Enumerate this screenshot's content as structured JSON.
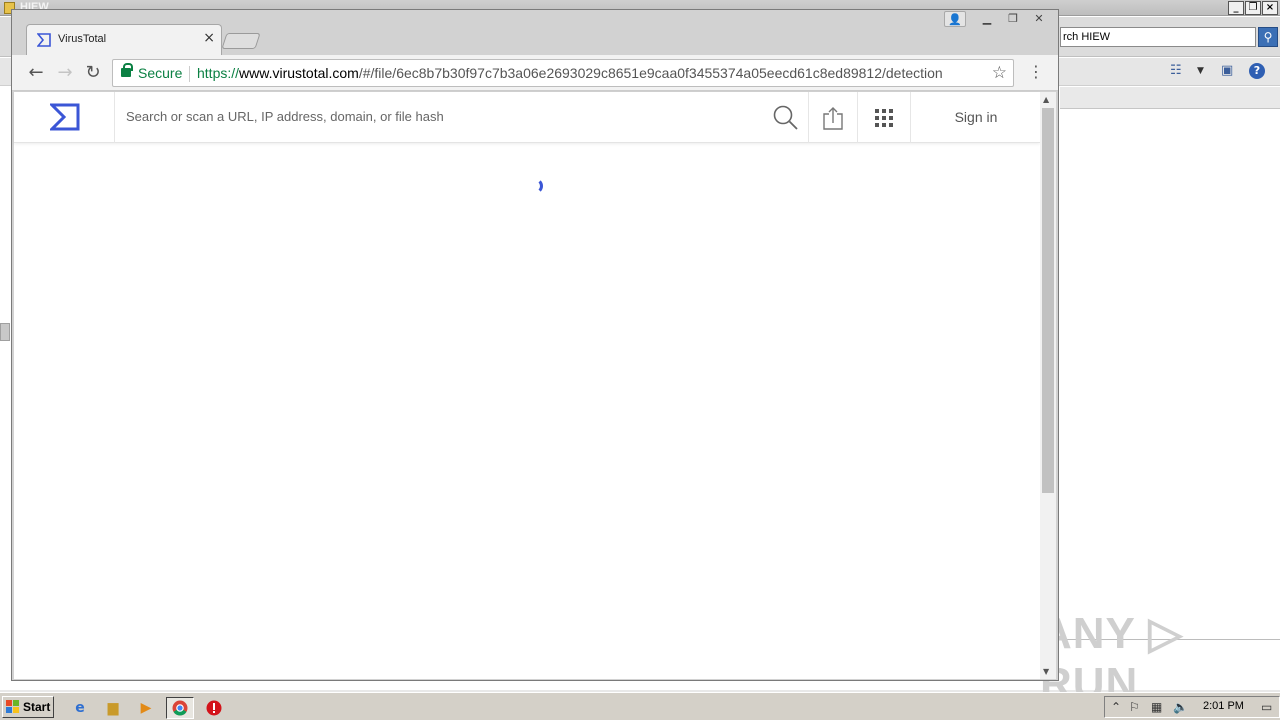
{
  "background_window": {
    "title": "HIEW",
    "search_value": "rch HIEW",
    "watermark": "ANY ▷ RUN"
  },
  "browser": {
    "tab_title": "VirusTotal",
    "tab_close": "×",
    "secure_label": "Secure",
    "url_scheme": "https://",
    "url_host": "www.virustotal.com",
    "url_path": "/#/file/6ec8b7b30f97c7b3a06e2693029c8651e9caa0f3455374a05eecd61c8ed89812/detection",
    "colors": {
      "secure": "#0b8043",
      "vt_accent": "#3b56d6"
    }
  },
  "virustotal": {
    "search_placeholder": "Search or scan a URL, IP address, domain, or file hash",
    "sign_in": "Sign in"
  },
  "taskbar": {
    "start_label": "Start",
    "clock": "2:01 PM"
  }
}
